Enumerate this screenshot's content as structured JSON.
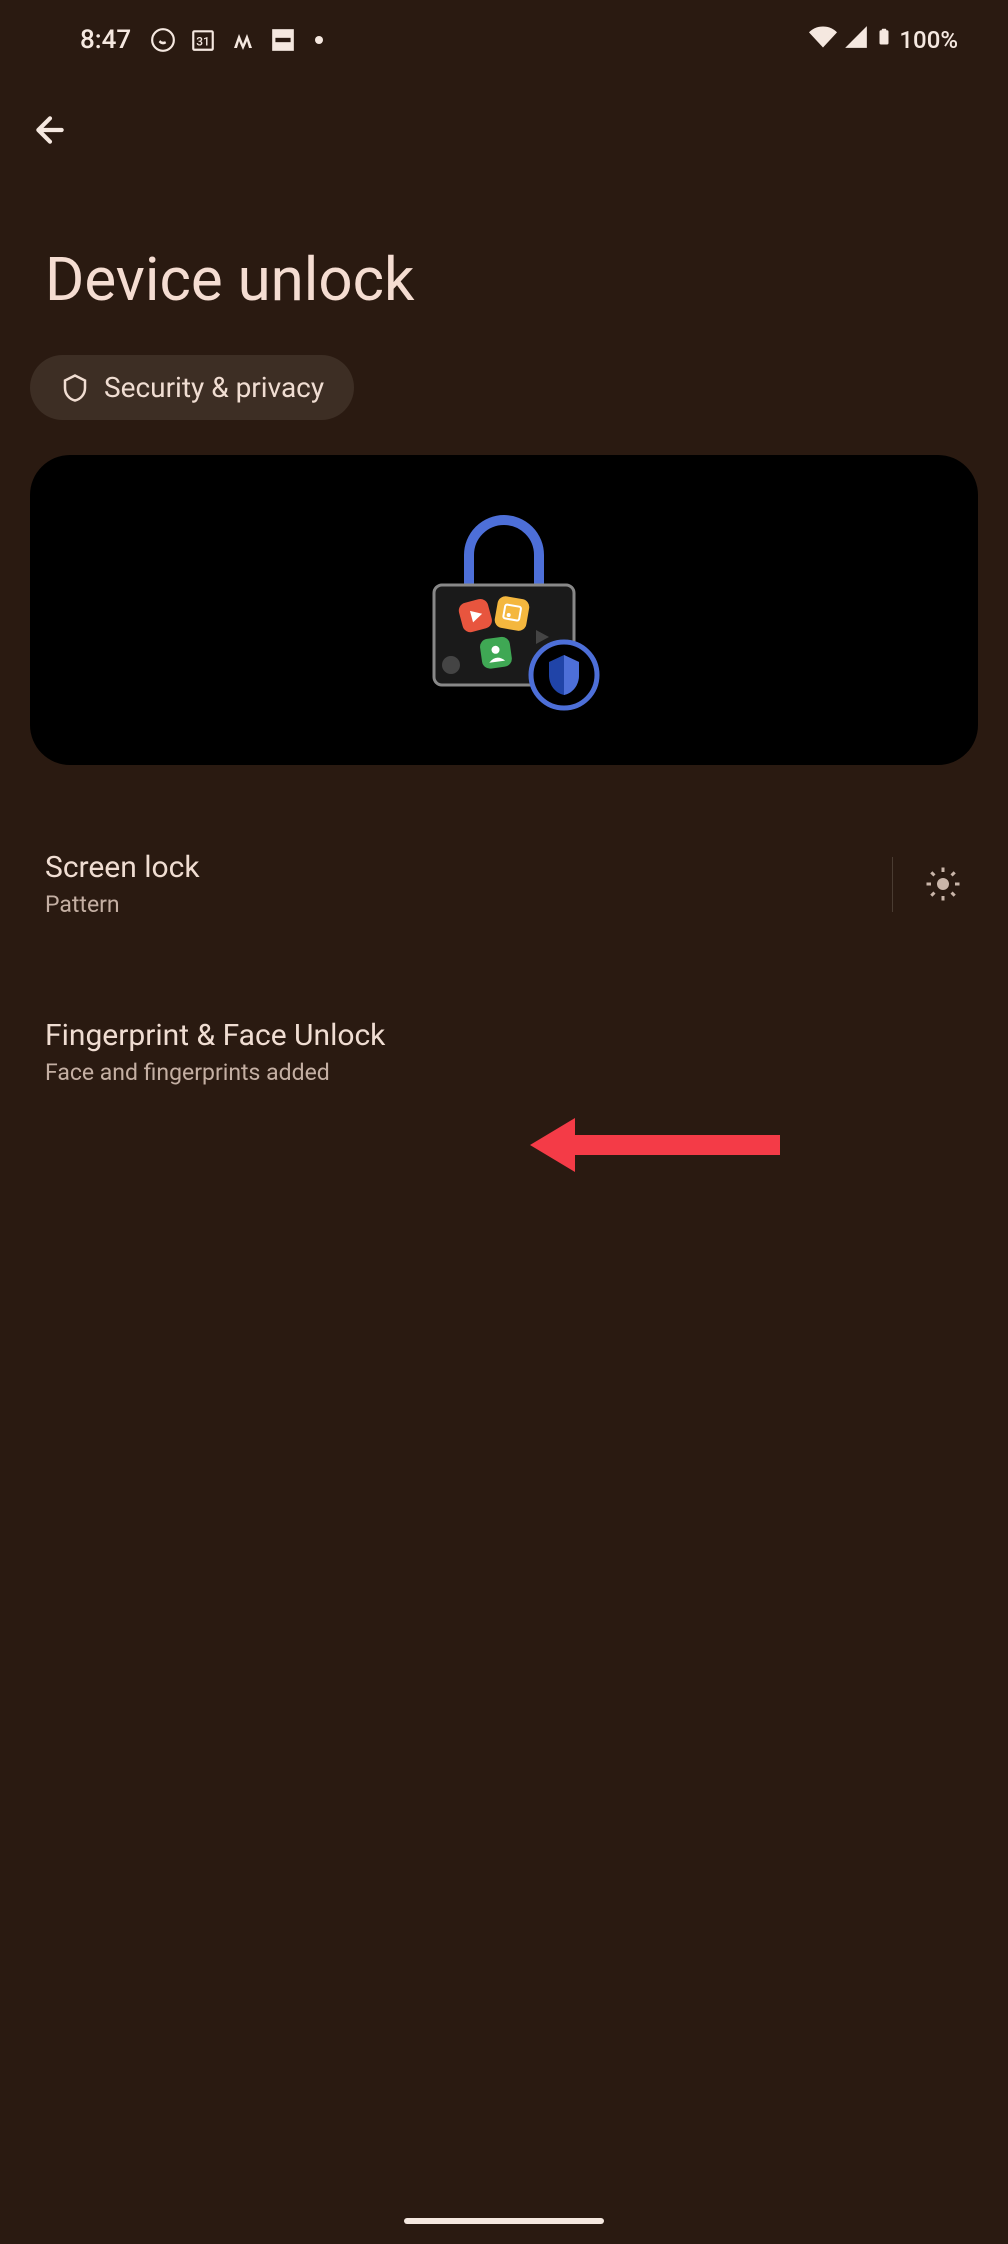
{
  "statusBar": {
    "time": "8:47",
    "batteryText": "100%"
  },
  "header": {
    "title": "Device unlock"
  },
  "chip": {
    "label": "Security & privacy"
  },
  "items": [
    {
      "title": "Screen lock",
      "subtitle": "Pattern"
    },
    {
      "title": "Fingerprint & Face Unlock",
      "subtitle": "Face and fingerprints added"
    }
  ]
}
